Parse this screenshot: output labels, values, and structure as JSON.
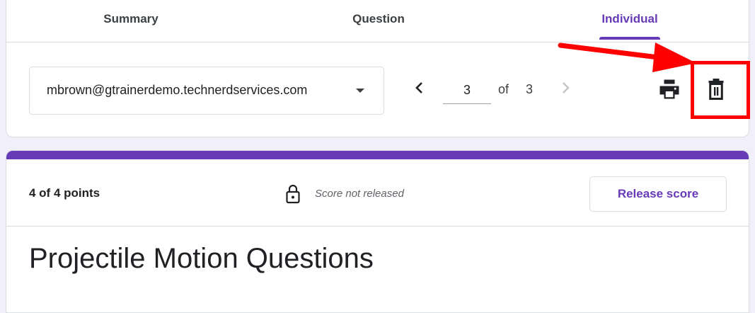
{
  "tabs": [
    {
      "label": "Summary"
    },
    {
      "label": "Question"
    },
    {
      "label": "Individual",
      "active": true
    }
  ],
  "respondent": {
    "email": "mbrown@gtrainerdemo.technerdservices.com"
  },
  "pager": {
    "current": "3",
    "of_label": "of",
    "total": "3"
  },
  "actions": {
    "print_icon": "print-icon",
    "delete_icon": "trash-icon"
  },
  "annotation": {
    "color": "#ff0000",
    "target": "delete-button"
  },
  "response": {
    "points": "4 of 4 points",
    "score_status": "Score not released",
    "release_label": "Release score"
  },
  "form": {
    "title": "Projectile Motion Questions"
  },
  "colors": {
    "accent": "#673ab7",
    "background": "#f1effa"
  }
}
